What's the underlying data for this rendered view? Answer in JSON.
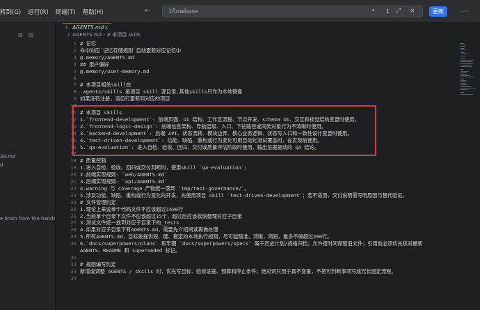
{
  "titlebar": {
    "menu": [
      "转到(G)",
      "运行(R)",
      "终端(T)",
      "帮助(H)"
    ],
    "search_text": "1flowbase",
    "match_count": "1",
    "update_label": "更新"
  },
  "sidebar": {
    "fragments": [
      "28.md",
      "d",
      "e brain from the hands..."
    ]
  },
  "tab": {
    "label": "AGENTS.md",
    "icon": "markdown-icon"
  },
  "breadcrumb": {
    "file": "AGENTS.md",
    "section": "# 本项目 skills"
  },
  "editor": {
    "lines": [
      {
        "n": "1",
        "text": "# 记忆",
        "kind": "h"
      },
      {
        "n": "2",
        "text": "命中对应`记忆存储规则`自动更新对应记忆中",
        "kind": "n"
      },
      {
        "n": "3",
        "text": "@.memory/AGENTS.md",
        "kind": "n"
      },
      {
        "n": "4",
        "text": "## 用户偏好",
        "kind": "h"
      },
      {
        "n": "5",
        "text": "@.memory/user-memory.md",
        "kind": "n"
      },
      {
        "n": "6",
        "text": "",
        "kind": "n"
      },
      {
        "n": "7",
        "text": "# 本项目相关skill在",
        "kind": "h"
      },
      {
        "n": "8",
        "text": ".agents/skills 是项目 skill 源目录,其他skills只作为本地镜像",
        "kind": "n"
      },
      {
        "n": "9",
        "text": "如果没有注册，请自行更新到对应的项目",
        "kind": "n"
      },
      {
        "n": "10",
        "text": "",
        "kind": "n"
      },
      {
        "n": "11",
        "text": "# 本项目 skills",
        "kind": "h"
      },
      {
        "n": "12",
        "text": "1.`frontend-development`: 前端页面、UI 结构、工作区流程、节点开发、schema UI、交互和视觉结构变更时使用。",
        "kind": "n"
      },
      {
        "n": "13",
        "text": "2.`frontend-logic-design`: 前端信息架构、导航层级、入口、下钻路径或同类对象行为不清晰时使用。",
        "kind": "n"
      },
      {
        "n": "14",
        "text": "3.`backend-development`: 后端 API、状态流转、模块边界、核心业务逻辑、状态写入口和一致性设计变更时使用。",
        "kind": "n"
      },
      {
        "n": "15",
        "text": "4.`test-driven-development`: 功能、缺陷、重构或行为变化可用自动化测试覆盖时，在实现前使用。",
        "kind": "n"
      },
      {
        "n": "16",
        "text": "5.`qa-evaluation`: 进入自检、验收、回归、交付或质量评估阶段时使用，输出证据驱动的 QA 结论。",
        "kind": "n"
      },
      {
        "n": "17",
        "text": "",
        "kind": "n"
      },
      {
        "n": "18",
        "text": "# 质量控制",
        "kind": "h"
      },
      {
        "n": "19",
        "text": "1.进入自检、验收、回归或交付判断时，使用skill `qa-evaluation`;",
        "kind": "n"
      },
      {
        "n": "20",
        "text": "2.前端实现规则: `web/AGENTS.md`",
        "kind": "n"
      },
      {
        "n": "21",
        "text": "3.后端实现规则: `api/AGENTS.md`",
        "kind": "n"
      },
      {
        "n": "22",
        "text": "4.warning 与 coverage 产物统一落到 `tmp/test-governance/`。",
        "kind": "n"
      },
      {
        "n": "23",
        "text": "5.涉及功能、缺陷、重构或行为变化的开发，先使用项目 skill `test-driven-development`；若不适用，交付说明需写明原因与替代验证。",
        "kind": "n"
      },
      {
        "n": "24",
        "text": "# 文件管理约定",
        "kind": "h"
      },
      {
        "n": "25",
        "text": "1.理论上来说单个代码文件不应该超过1500行",
        "kind": "n"
      },
      {
        "n": "26",
        "text": "2.当前单个目录下文件不应该超过15个，超过后应该收纳整理对应子目录",
        "kind": "n"
      },
      {
        "n": "27",
        "text": "3.测试文件统一放到对应子目录下的_tests",
        "kind": "n"
      },
      {
        "n": "28",
        "text": "4.如果对应子目录下有AGENTS.md，需要先介绍阅读再做处理",
        "kind": "n"
      },
      {
        "n": "29",
        "text": "5.所有AGENTS.md，目标是提供短、硬、稳定的本地执行规则，尽可能精准，清晰，简短，最多不得超过200行。",
        "kind": "n"
      },
      {
        "n": "30",
        "text": "6.`docs/superpowers/plans` 和早期 `docs/superpowers/specs` 属于历史计划/规格归档，允许按时间保留旧文件；引用前必须优先核对最新",
        "kind": "n"
      },
      {
        "n": "",
        "text": "AGENTS、README 和 superseded 标记。",
        "kind": "n"
      },
      {
        "n": "31",
        "text": "",
        "kind": "n"
      },
      {
        "n": "32",
        "text": "# 规则编写约定",
        "kind": "h"
      },
      {
        "n": "33",
        "text": "新增或调整 AGENTS / skills 时，优先写目标、验收证据、预算和停止条件；绝对词只用于真不变量，不把可判断事项写成冗长固定流程。",
        "kind": "n"
      },
      {
        "n": "34",
        "text": "",
        "kind": "n"
      }
    ]
  },
  "colors": {
    "accent": "#3574f0",
    "highlight_box": "#e03b3b",
    "heading": "#7aa2f7"
  }
}
